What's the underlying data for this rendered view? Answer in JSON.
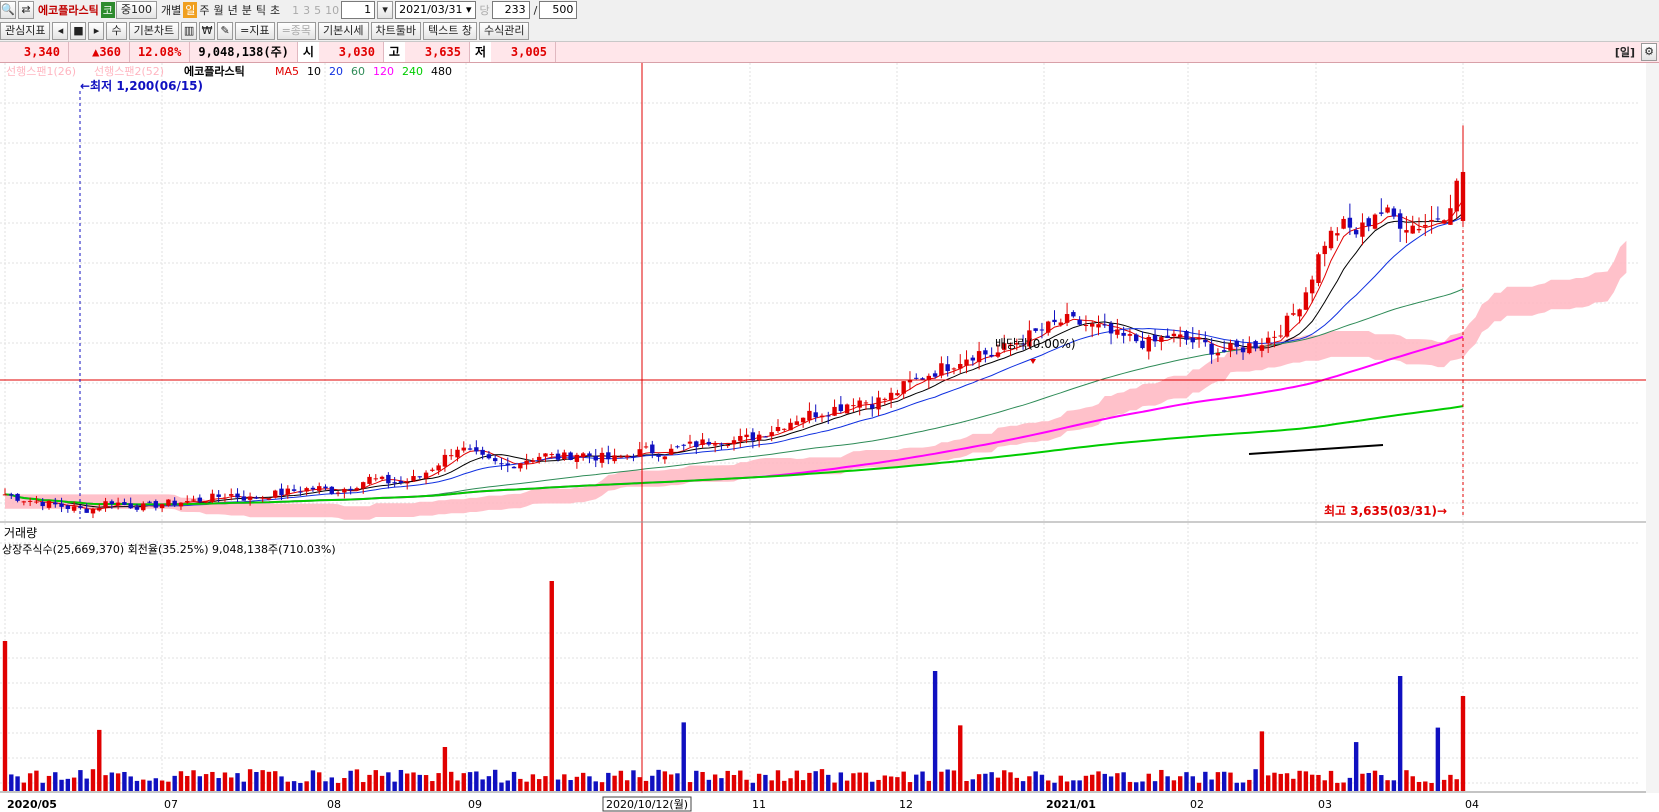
{
  "toolbar1": {
    "stock_name": "에코플라스틱",
    "market_tag": "코",
    "index_tag": "중100",
    "items": [
      "개별",
      "일",
      "주",
      "월",
      "년",
      "분",
      "틱",
      "초"
    ],
    "period_values": [
      "1",
      "3",
      "5",
      "10"
    ],
    "period_input": "1",
    "date_value": "2021/03/31",
    "dang_label": "당",
    "count_value": "233",
    "slash": "/",
    "total_value": "500"
  },
  "toolbar2": {
    "buttons": [
      "관심지표",
      "기본차트",
      "=지표",
      "=종목",
      "기본시세",
      "차트툴바",
      "텍스트 창",
      "수식관리"
    ],
    "su_label": "수",
    "won_label": "₩"
  },
  "quote": {
    "price": "3,340",
    "change": "▲360",
    "pct": "12.08%",
    "volume": "9,048,138(주)",
    "open_label": "시",
    "open": "3,030",
    "high_label": "고",
    "high": "3,635",
    "low_label": "저",
    "low": "3,005",
    "period_tag": "[일]"
  },
  "legend": {
    "span1": "선행스팬1(26)",
    "span2": "선행스팬2(52)",
    "name": "에코플라스틱",
    "ma_label": "MA",
    "ma_items": [
      {
        "label": "5",
        "color": "#e00000"
      },
      {
        "label": "10",
        "color": "#000000"
      },
      {
        "label": "20",
        "color": "#1030e0"
      },
      {
        "label": "60",
        "color": "#2e8b57"
      },
      {
        "label": "120",
        "color": "#ff00ff"
      },
      {
        "label": "240",
        "color": "#00cc00"
      },
      {
        "label": "480",
        "color": "#000000"
      }
    ]
  },
  "annotations": {
    "low": "←최저 1,200(06/15)",
    "high": "최고 3,635(03/31)→",
    "dividend": "배당락(0.00%)"
  },
  "volume_panel": {
    "title": "거래량",
    "info": "상장주식수(25,669,370) 회전율(35.25%) 9,048,138주(710.03%)"
  },
  "x_axis": {
    "labels": [
      "2020/05",
      "07",
      "08",
      "09",
      "11",
      "12",
      "2021/01",
      "02",
      "03",
      "04"
    ],
    "crosshair_date": "2020/10/12(월)"
  },
  "colors": {
    "up": "#e00000",
    "down": "#1010c0",
    "cloud": "#ffb6c1",
    "crosshair": "#e00000"
  },
  "chart_data": {
    "type": "candlestick",
    "x_start": "2020/05",
    "x_end": "2021/03/31",
    "ohlc_path": [
      1300,
      1270,
      1250,
      1230,
      1210,
      1200,
      1260,
      1230,
      1220,
      1240,
      1250,
      1260,
      1280,
      1300,
      1270,
      1290,
      1310,
      1330,
      1340,
      1320,
      1350,
      1400,
      1380,
      1370,
      1420,
      1500,
      1600,
      1550,
      1500,
      1480,
      1520,
      1550,
      1530,
      1560,
      1540,
      1520,
      1550,
      1580,
      1560,
      1600,
      1620,
      1650,
      1640,
      1660,
      1700,
      1750,
      1800,
      1820,
      1850,
      1900,
      1880,
      1920,
      2000,
      2050,
      2100,
      2150,
      2200,
      2180,
      2250,
      2300,
      2350,
      2400,
      2380,
      2350,
      2300,
      2280,
      2250,
      2300,
      2280,
      2250,
      2200,
      2220,
      2250,
      2300,
      2400,
      2600,
      2900,
      3000,
      2950,
      3100,
      3050,
      3000,
      3020,
      3100,
      3340
    ],
    "ma_lines": [
      "5",
      "10",
      "20",
      "60",
      "120",
      "240",
      "480"
    ],
    "volume_shares_last": 9048138,
    "high": 3635,
    "high_date": "03/31",
    "low": 1200,
    "low_date": "06/15"
  }
}
